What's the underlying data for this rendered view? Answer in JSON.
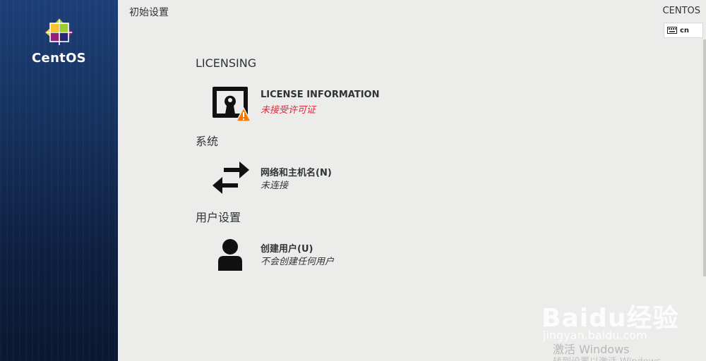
{
  "sidebar": {
    "brand": "CentOS",
    "logo_icon": "centos-logo-icon"
  },
  "header": {
    "title": "初始设置",
    "distribution": "CENTOS",
    "keyboard_layout": "cn",
    "keyboard_icon": "keyboard-icon"
  },
  "categories": [
    {
      "title": "LICENSING",
      "spokes": [
        {
          "name": "LICENSE INFORMATION",
          "status": "未接受许可证",
          "icon": "license-warning-icon",
          "status_color": "#e0273b"
        }
      ]
    },
    {
      "title": "系统",
      "spokes": [
        {
          "name": "网络和主机名(N)",
          "status": "未连接",
          "icon": "network-arrows-icon"
        }
      ]
    },
    {
      "title": "用户设置",
      "spokes": [
        {
          "name": "创建用户(U)",
          "status": "不会创建任何用户",
          "icon": "user-icon"
        }
      ]
    }
  ],
  "watermark": {
    "brand": "Baidu经验",
    "url": "jingyan.baidu.com",
    "activate_title": "激活 Windows",
    "activate_sub": "转到设置以激活 Windows"
  }
}
